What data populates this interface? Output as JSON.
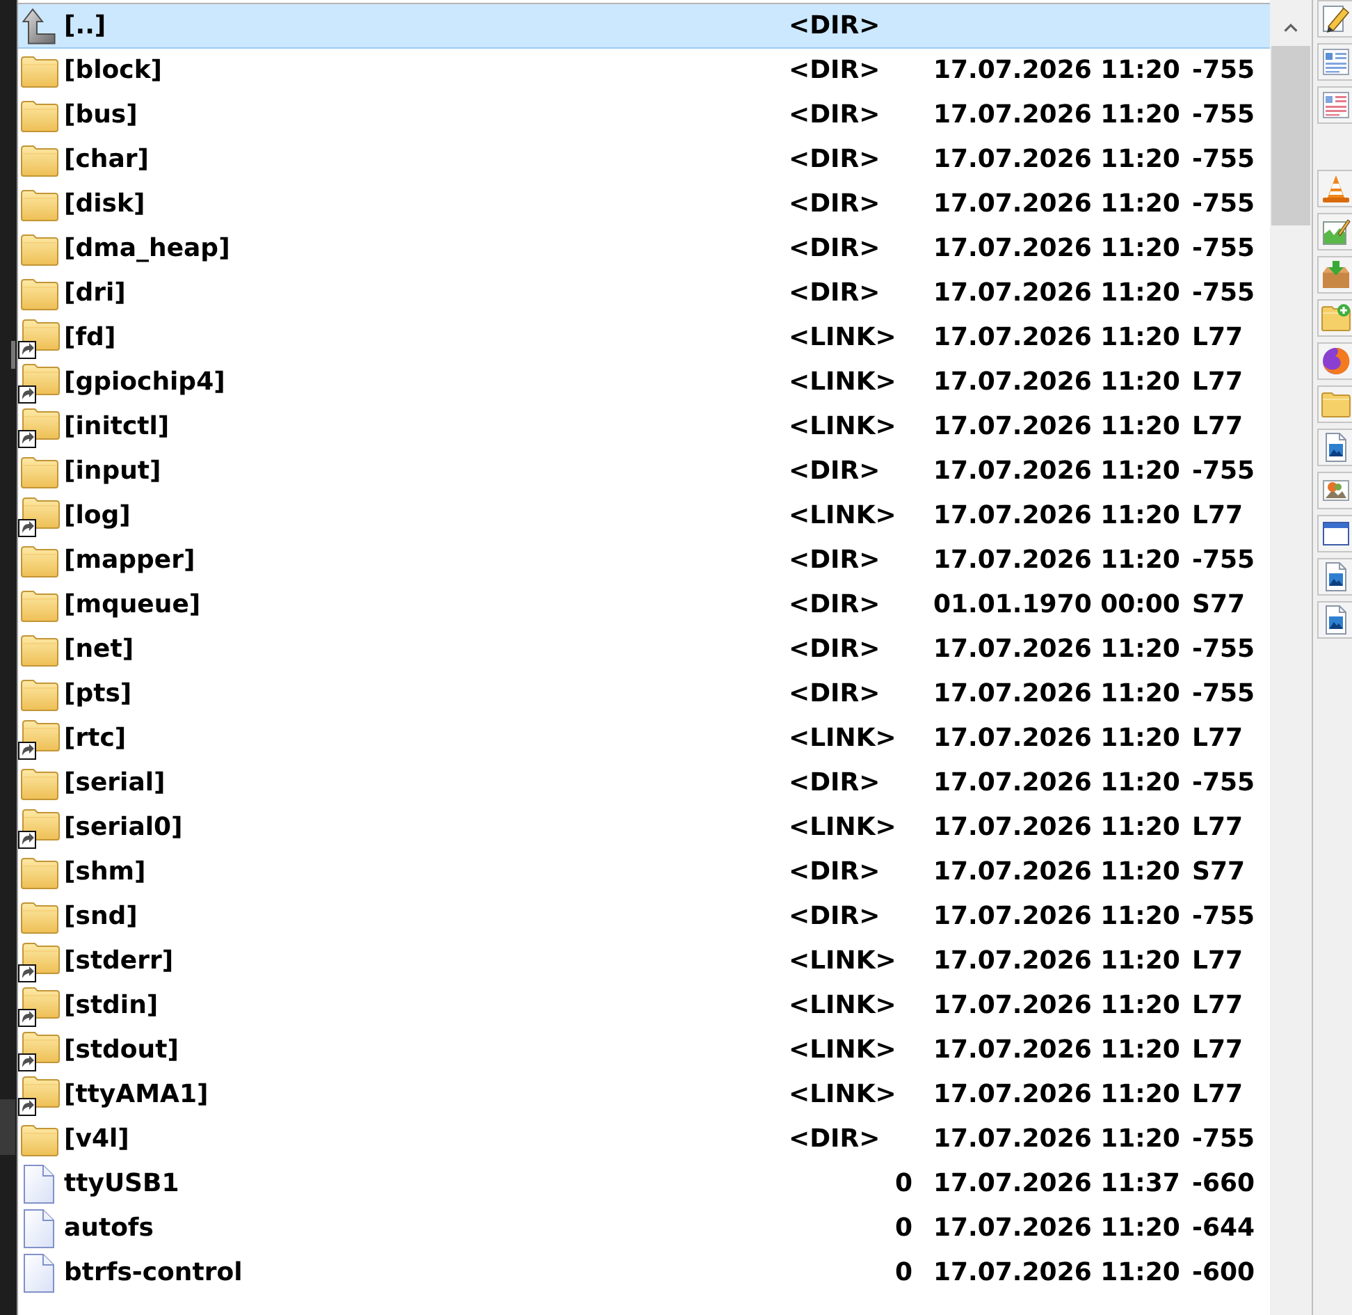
{
  "file_list": {
    "rows": [
      {
        "kind": "up",
        "name": "[..]",
        "size": "<DIR>",
        "selected": true
      },
      {
        "kind": "dir",
        "name": "[block]",
        "size": "<DIR>",
        "date": "17.07.2026 11:20",
        "attributes": "-755",
        "selected": false
      },
      {
        "kind": "dir",
        "name": "[bus]",
        "size": "<DIR>",
        "date": "17.07.2026 11:20",
        "attributes": "-755",
        "selected": false
      },
      {
        "kind": "dir",
        "name": "[char]",
        "size": "<DIR>",
        "date": "17.07.2026 11:20",
        "attributes": "-755",
        "selected": false
      },
      {
        "kind": "dir",
        "name": "[disk]",
        "size": "<DIR>",
        "date": "17.07.2026 11:20",
        "attributes": "-755",
        "selected": false
      },
      {
        "kind": "dir",
        "name": "[dma_heap]",
        "size": "<DIR>",
        "date": "17.07.2026 11:20",
        "attributes": "-755",
        "selected": false
      },
      {
        "kind": "dir",
        "name": "[dri]",
        "size": "<DIR>",
        "date": "17.07.2026 11:20",
        "attributes": "-755",
        "selected": false
      },
      {
        "kind": "link",
        "name": "[fd]",
        "size": "<LINK>",
        "date": "17.07.2026 11:20",
        "attributes": "L77",
        "selected": false
      },
      {
        "kind": "link",
        "name": "[gpiochip4]",
        "size": "<LINK>",
        "date": "17.07.2026 11:20",
        "attributes": "L77",
        "selected": false
      },
      {
        "kind": "link",
        "name": "[initctl]",
        "size": "<LINK>",
        "date": "17.07.2026 11:20",
        "attributes": "L77",
        "selected": false
      },
      {
        "kind": "dir",
        "name": "[input]",
        "size": "<DIR>",
        "date": "17.07.2026 11:20",
        "attributes": "-755",
        "selected": false
      },
      {
        "kind": "link",
        "name": "[log]",
        "size": "<LINK>",
        "date": "17.07.2026 11:20",
        "attributes": "L77",
        "selected": false
      },
      {
        "kind": "dir",
        "name": "[mapper]",
        "size": "<DIR>",
        "date": "17.07.2026 11:20",
        "attributes": "-755",
        "selected": false
      },
      {
        "kind": "dir",
        "name": "[mqueue]",
        "size": "<DIR>",
        "date": "01.01.1970 00:00",
        "attributes": "S77",
        "selected": false
      },
      {
        "kind": "dir",
        "name": "[net]",
        "size": "<DIR>",
        "date": "17.07.2026 11:20",
        "attributes": "-755",
        "selected": false
      },
      {
        "kind": "dir",
        "name": "[pts]",
        "size": "<DIR>",
        "date": "17.07.2026 11:20",
        "attributes": "-755",
        "selected": false
      },
      {
        "kind": "link",
        "name": "[rtc]",
        "size": "<LINK>",
        "date": "17.07.2026 11:20",
        "attributes": "L77",
        "selected": false
      },
      {
        "kind": "dir",
        "name": "[serial]",
        "size": "<DIR>",
        "date": "17.07.2026 11:20",
        "attributes": "-755",
        "selected": false
      },
      {
        "kind": "link",
        "name": "[serial0]",
        "size": "<LINK>",
        "date": "17.07.2026 11:20",
        "attributes": "L77",
        "selected": false
      },
      {
        "kind": "dir",
        "name": "[shm]",
        "size": "<DIR>",
        "date": "17.07.2026 11:20",
        "attributes": "S77",
        "selected": false
      },
      {
        "kind": "dir",
        "name": "[snd]",
        "size": "<DIR>",
        "date": "17.07.2026 11:20",
        "attributes": "-755",
        "selected": false
      },
      {
        "kind": "link",
        "name": "[stderr]",
        "size": "<LINK>",
        "date": "17.07.2026 11:20",
        "attributes": "L77",
        "selected": false
      },
      {
        "kind": "link",
        "name": "[stdin]",
        "size": "<LINK>",
        "date": "17.07.2026 11:20",
        "attributes": "L77",
        "selected": false
      },
      {
        "kind": "link",
        "name": "[stdout]",
        "size": "<LINK>",
        "date": "17.07.2026 11:20",
        "attributes": "L77",
        "selected": false
      },
      {
        "kind": "link",
        "name": "[ttyAMA1]",
        "size": "<LINK>",
        "date": "17.07.2026 11:20",
        "attributes": "L77",
        "selected": false
      },
      {
        "kind": "dir",
        "name": "[v4l]",
        "size": "<DIR>",
        "date": "17.07.2026 11:20",
        "attributes": "-755",
        "selected": false
      },
      {
        "kind": "file",
        "name": "ttyUSB1",
        "size": "0",
        "date": "17.07.2026 11:37",
        "attributes": "-660",
        "selected": false
      },
      {
        "kind": "file",
        "name": "autofs",
        "size": "0",
        "date": "17.07.2026 11:20",
        "attributes": "-644",
        "selected": false
      },
      {
        "kind": "file",
        "name": "btrfs-control",
        "size": "0",
        "date": "17.07.2026 11:20",
        "attributes": "-600",
        "selected": false
      }
    ]
  }
}
